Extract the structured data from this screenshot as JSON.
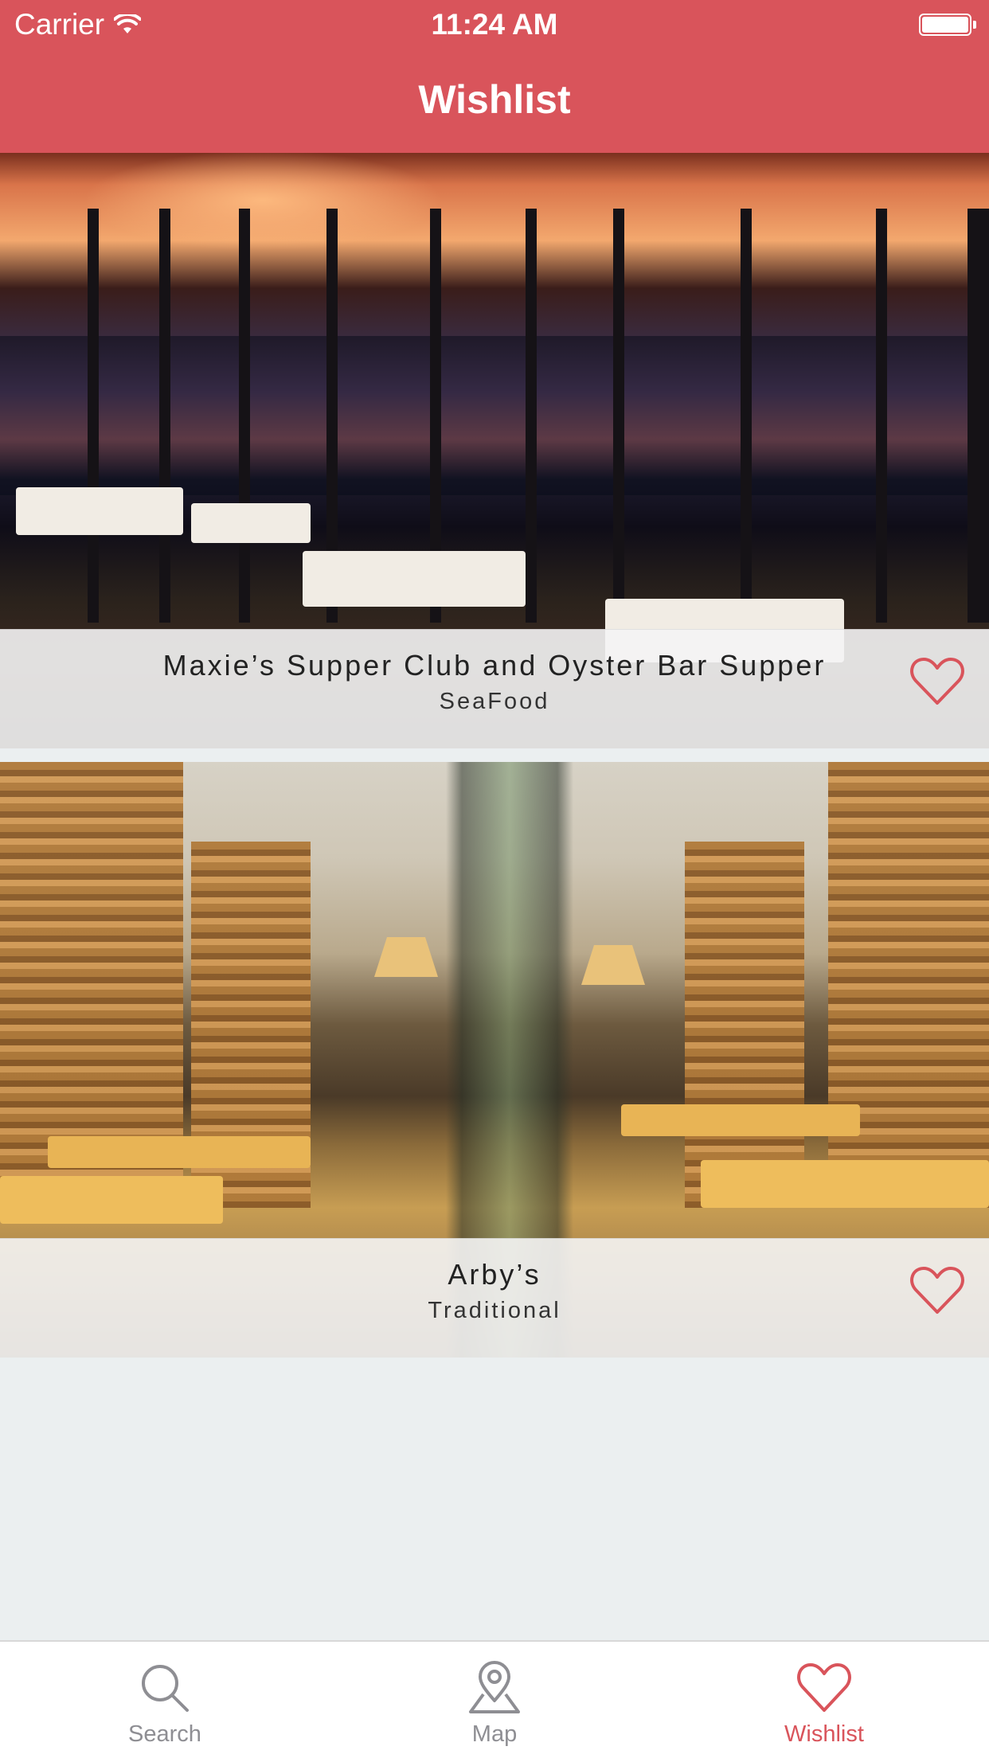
{
  "status_bar": {
    "carrier": "Carrier",
    "time": "11:24 AM"
  },
  "nav": {
    "title": "Wishlist"
  },
  "wishlist": [
    {
      "name": "Maxie’s Supper Club and Oyster Bar Supper",
      "category": "SeaFood",
      "favorited": true
    },
    {
      "name": "Arby’s",
      "category": "Traditional",
      "favorited": true
    }
  ],
  "tab_bar": {
    "tabs": [
      {
        "label": "Search",
        "icon": "search-icon",
        "active": false
      },
      {
        "label": "Map",
        "icon": "map-pin-icon",
        "active": false
      },
      {
        "label": "Wishlist",
        "icon": "heart-icon",
        "active": true
      }
    ]
  },
  "colors": {
    "accent": "#d9545b",
    "background": "#ebeff0",
    "tab_inactive": "#8e8e93"
  }
}
